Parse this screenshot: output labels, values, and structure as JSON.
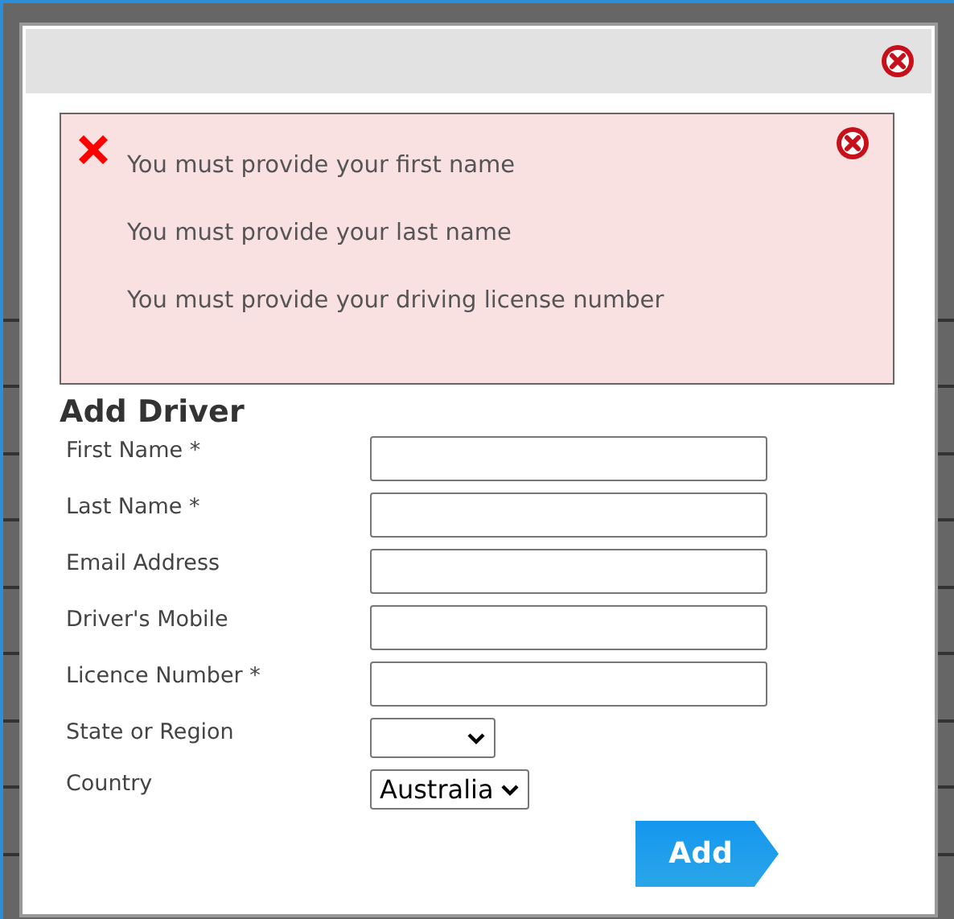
{
  "errors": [
    "You must provide your first name",
    "You must provide your last name",
    "You must provide your driving license number"
  ],
  "form": {
    "title": "Add Driver",
    "fields": [
      {
        "label": "First Name *",
        "kind": "text"
      },
      {
        "label": "Last Name *",
        "kind": "text"
      },
      {
        "label": "Email Address",
        "kind": "text"
      },
      {
        "label": "Driver's Mobile",
        "kind": "text"
      },
      {
        "label": "Licence Number *",
        "kind": "text"
      },
      {
        "label": "State or Region",
        "kind": "select"
      },
      {
        "label": "Country",
        "kind": "select",
        "value": "Australia"
      }
    ]
  },
  "buttons": [
    "Add"
  ]
}
